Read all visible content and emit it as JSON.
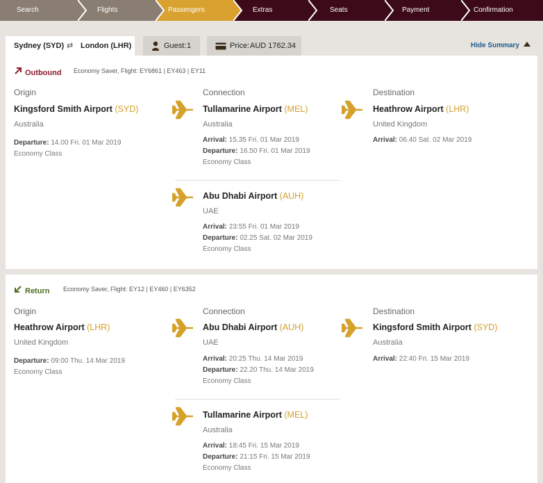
{
  "steps": [
    "Search",
    "Flights",
    "Passengers",
    "Extras",
    "Seats",
    "Payment",
    "Confirmation"
  ],
  "active_step": "Passengers",
  "colors": {
    "steps_bg": "#3c0a18",
    "steps_done": "#8a7e73",
    "steps_active": "#d9a230",
    "accent": "#d6a12b",
    "outbound": "#8b1a2b",
    "return": "#4d6b1d",
    "link": "#1e5a8c"
  },
  "header": {
    "origin": "Sydney (SYD)",
    "swap_icon": "swap-arrows-icon",
    "destination": "London (LHR)",
    "guest_label": "Guest:",
    "guest_count": "1",
    "price_label": "Price:",
    "price_value": "AUD 1762.34",
    "hide_summary": "Hide Summary"
  },
  "outbound": {
    "label": "Outbound",
    "flight_info": "Economy Saver, Flight: EY6861 | EY463 | EY11",
    "origin_heading": "Origin",
    "connection_heading": "Connection",
    "destination_heading": "Destination",
    "origin": {
      "name": "Kingsford Smith Airport",
      "code": "(SYD)",
      "country": "Australia",
      "departure_label": "Departure:",
      "departure": "14.00 Fri. 01 Mar 2019",
      "cabin": "Economy Class"
    },
    "connections": [
      {
        "name": "Tullamarine Airport",
        "code": "(MEL)",
        "country": "Australia",
        "arrival_label": "Arrival:",
        "arrival": "15.35 Fri. 01 Mar 2019",
        "departure_label": "Departure:",
        "departure": "16.50 Fri. 01 Mar 2019",
        "cabin": "Economy Class"
      },
      {
        "name": "Abu Dhabi Airport",
        "code": "(AUH)",
        "country": "UAE",
        "arrival_label": "Arrival:",
        "arrival": "23:55 Fri. 01 Mar 2019",
        "departure_label": "Departure:",
        "departure": "02.25 Sat. 02 Mar 2019",
        "cabin": "Economy Class"
      }
    ],
    "destination": {
      "name": "Heathrow Airport",
      "code": "(LHR)",
      "country": "United Kingdom",
      "arrival_label": "Arrival:",
      "arrival": "06.40 Sat. 02 Mar 2019"
    }
  },
  "return": {
    "label": "Return",
    "flight_info": "Economy Saver, Flight: EY12 | EY460 | EY6352",
    "origin_heading": "Origin",
    "connection_heading": "Connection",
    "destination_heading": "Destination",
    "origin": {
      "name": "Heathrow Airport",
      "code": "(LHR)",
      "country": "United Kingdom",
      "departure_label": "Departure:",
      "departure": "09:00 Thu. 14 Mar 2019",
      "cabin": "Economy Class"
    },
    "connections": [
      {
        "name": "Abu Dhabi Airport",
        "code": "(AUH)",
        "country": "UAE",
        "arrival_label": "Arrival:",
        "arrival": "20:25 Thu. 14 Mar 2019",
        "departure_label": "Departure:",
        "departure": "22.20 Thu. 14 Mar 2019",
        "cabin": "Economy Class"
      },
      {
        "name": "Tullamarine Airport",
        "code": "(MEL)",
        "country": "Australia",
        "arrival_label": "Arrival:",
        "arrival": "18:45 Fri. 15 Mar 2019",
        "departure_label": "Departure:",
        "departure": "21:15 Fri. 15 Mar 2019",
        "cabin": "Economy Class"
      }
    ],
    "destination": {
      "name": "Kingsford Smith Airport",
      "code": "(SYD)",
      "country": "Australia",
      "arrival_label": "Arrival:",
      "arrival": "22:40 Fri. 15 Mar 2019"
    }
  }
}
